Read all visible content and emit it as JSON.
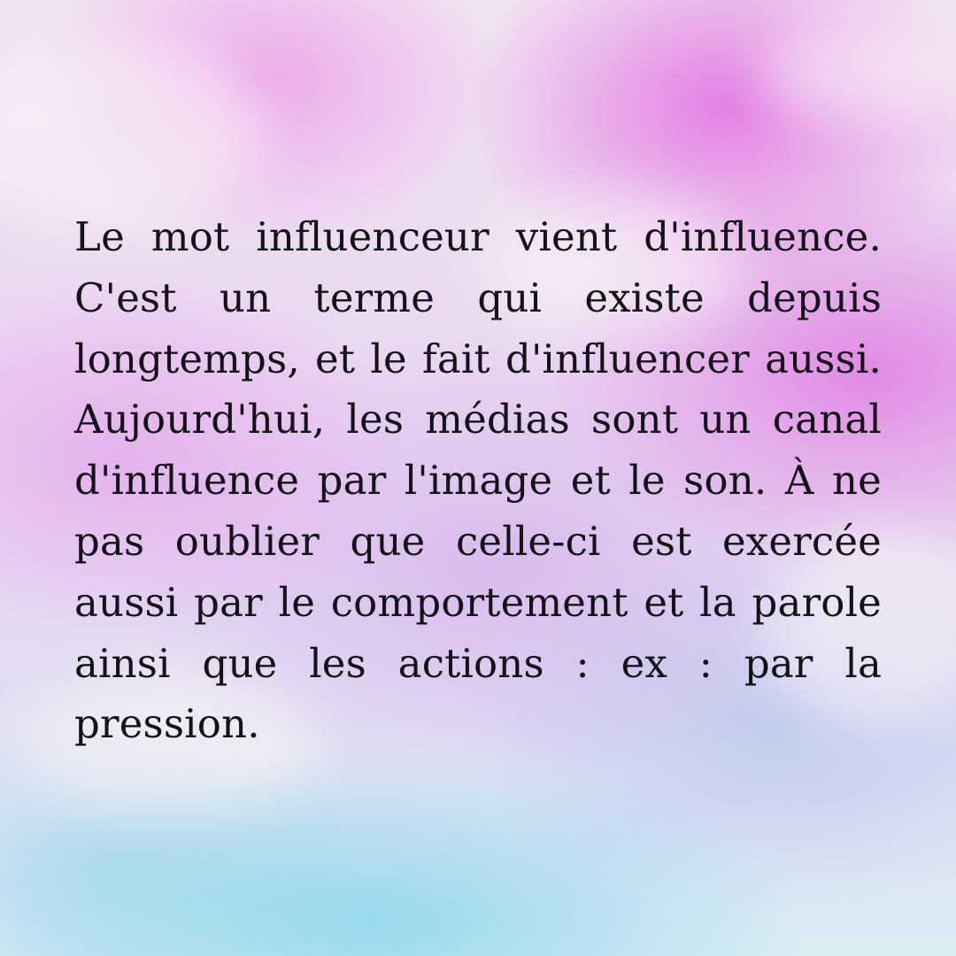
{
  "post": {
    "text": "Le mot influenceur vient d'influence. C'est un terme qui existe depuis longtemps, et le fait d'influencer aussi. Aujourd'hui, les médias sont un canal d'influence par l'image et le son. À ne pas oublier que celle-ci est exercée aussi par le comportement et la parole ainsi que les actions : ex : par la pression."
  },
  "colors": {
    "background_top": "#e26ee2",
    "background_bottom": "#82d2ec",
    "text": "#141218"
  }
}
